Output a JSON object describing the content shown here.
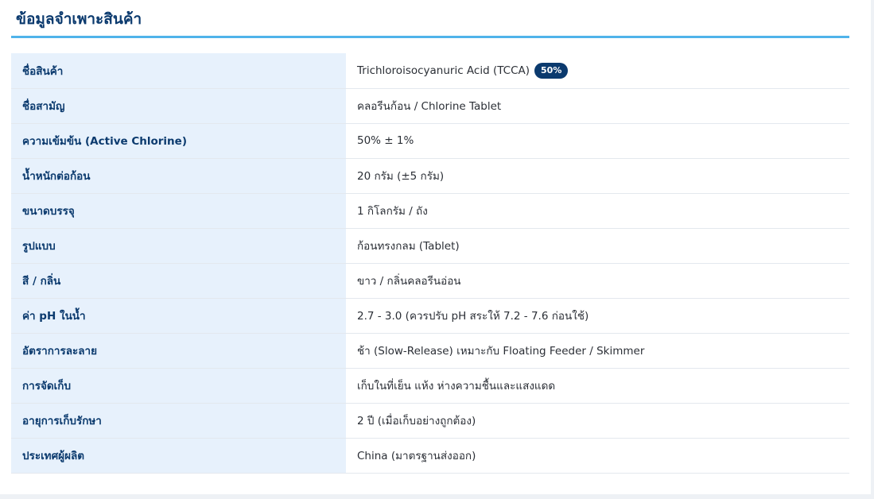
{
  "section": {
    "title": "ข้อมูลจำเพาะสินค้า"
  },
  "specs": [
    {
      "label": "ชื่อสินค้า",
      "value": "Trichloroisocyanuric Acid (TCCA)",
      "badge": "50%"
    },
    {
      "label": "ชื่อสามัญ",
      "value": "คลอรีนก้อน / Chlorine Tablet"
    },
    {
      "label": "ความเข้มข้น (Active Chlorine)",
      "value": "50% ± 1%"
    },
    {
      "label": "น้ำหนักต่อก้อน",
      "value": "20 กรัม (±5 กรัม)"
    },
    {
      "label": "ขนาดบรรจุ",
      "value": "1 กิโลกรัม / ถัง"
    },
    {
      "label": "รูปแบบ",
      "value": "ก้อนทรงกลม (Tablet)"
    },
    {
      "label": "สี / กลิ่น",
      "value": "ขาว / กลิ่นคลอรีนอ่อน"
    },
    {
      "label": "ค่า pH ในน้ำ",
      "value": "2.7 - 3.0 (ควรปรับ pH สระให้ 7.2 - 7.6 ก่อนใช้)"
    },
    {
      "label": "อัตราการละลาย",
      "value": "ช้า (Slow-Release) เหมาะกับ Floating Feeder / Skimmer"
    },
    {
      "label": "การจัดเก็บ",
      "value": "เก็บในที่เย็น แห้ง ห่างความชื้นและแสงแดด"
    },
    {
      "label": "อายุการเก็บรักษา",
      "value": "2 ปี (เมื่อเก็บอย่างถูกต้อง)"
    },
    {
      "label": "ประเทศผู้ผลิต",
      "value": "China (มาตรฐานส่งออก)"
    }
  ],
  "colors": {
    "accent": "#0b3a6e",
    "rule": "#4fb3ea",
    "label_bg": "#e7f1fc"
  }
}
